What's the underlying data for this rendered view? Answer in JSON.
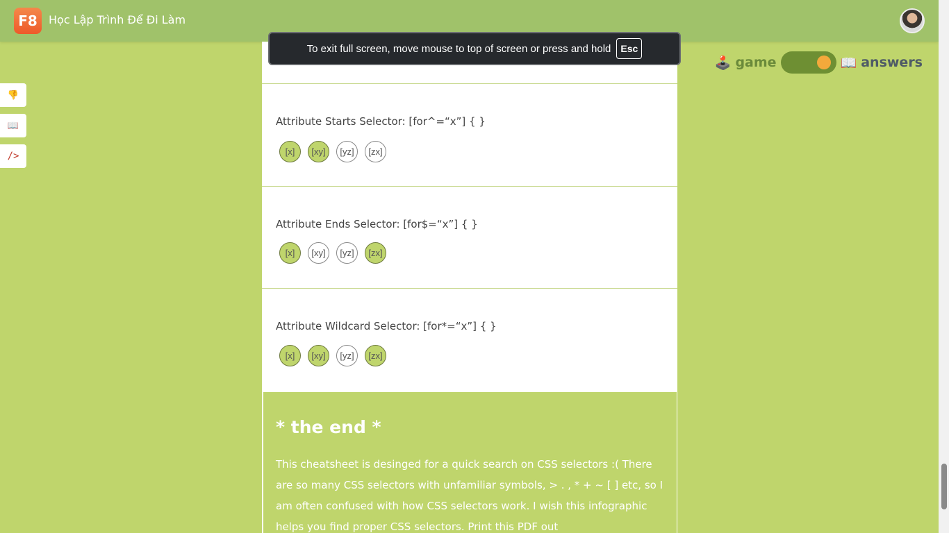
{
  "header": {
    "logo": "F8",
    "title": "Học Lập Trình Để Đi Làm"
  },
  "sidebar": {
    "items": [
      {
        "glyph": "👎",
        "icon": "thumbs-down-icon"
      },
      {
        "glyph": "📖",
        "icon": "book-icon"
      },
      {
        "glyph": "/>",
        "icon": "code-icon"
      }
    ]
  },
  "toggle": {
    "game_icon": "🕹️",
    "game_label": "game",
    "answers_icon": "📖",
    "answers_label": "answers"
  },
  "fullscreen_tip": {
    "text": "To exit full screen, move mouse to top of screen or press and hold",
    "key": "Esc"
  },
  "sections": [
    {
      "title": "Attribute Starts Selector: [for^=“x”] { }",
      "chips": [
        {
          "label": "[x]",
          "selected": true
        },
        {
          "label": "[xy]",
          "selected": true
        },
        {
          "label": "[yz]",
          "selected": false
        },
        {
          "label": "[zx]",
          "selected": false
        }
      ]
    },
    {
      "title": "Attribute Ends Selector: [for$=“x”] { }",
      "chips": [
        {
          "label": "[x]",
          "selected": true
        },
        {
          "label": "[xy]",
          "selected": false
        },
        {
          "label": "[yz]",
          "selected": false
        },
        {
          "label": "[zx]",
          "selected": true
        }
      ]
    },
    {
      "title": "Attribute Wildcard Selector: [for*=“x”] { }",
      "chips": [
        {
          "label": "[x]",
          "selected": true
        },
        {
          "label": "[xy]",
          "selected": true
        },
        {
          "label": "[yz]",
          "selected": false
        },
        {
          "label": "[zx]",
          "selected": true
        }
      ]
    }
  ],
  "end": {
    "title": "* the end *",
    "text": "This cheatsheet is desinged for a quick search on CSS selectors :( There are so many CSS selectors with unfamiliar symbols, > . , * + ~ [ ] etc, so I am often confused with how CSS selectors work. I wish this infographic helps you find proper CSS selectors. Print this PDF out"
  },
  "colors": {
    "accent": "#bfd56c",
    "header": "#a0c26a",
    "switch": "#6e8f33",
    "knob": "#f3a93b"
  }
}
